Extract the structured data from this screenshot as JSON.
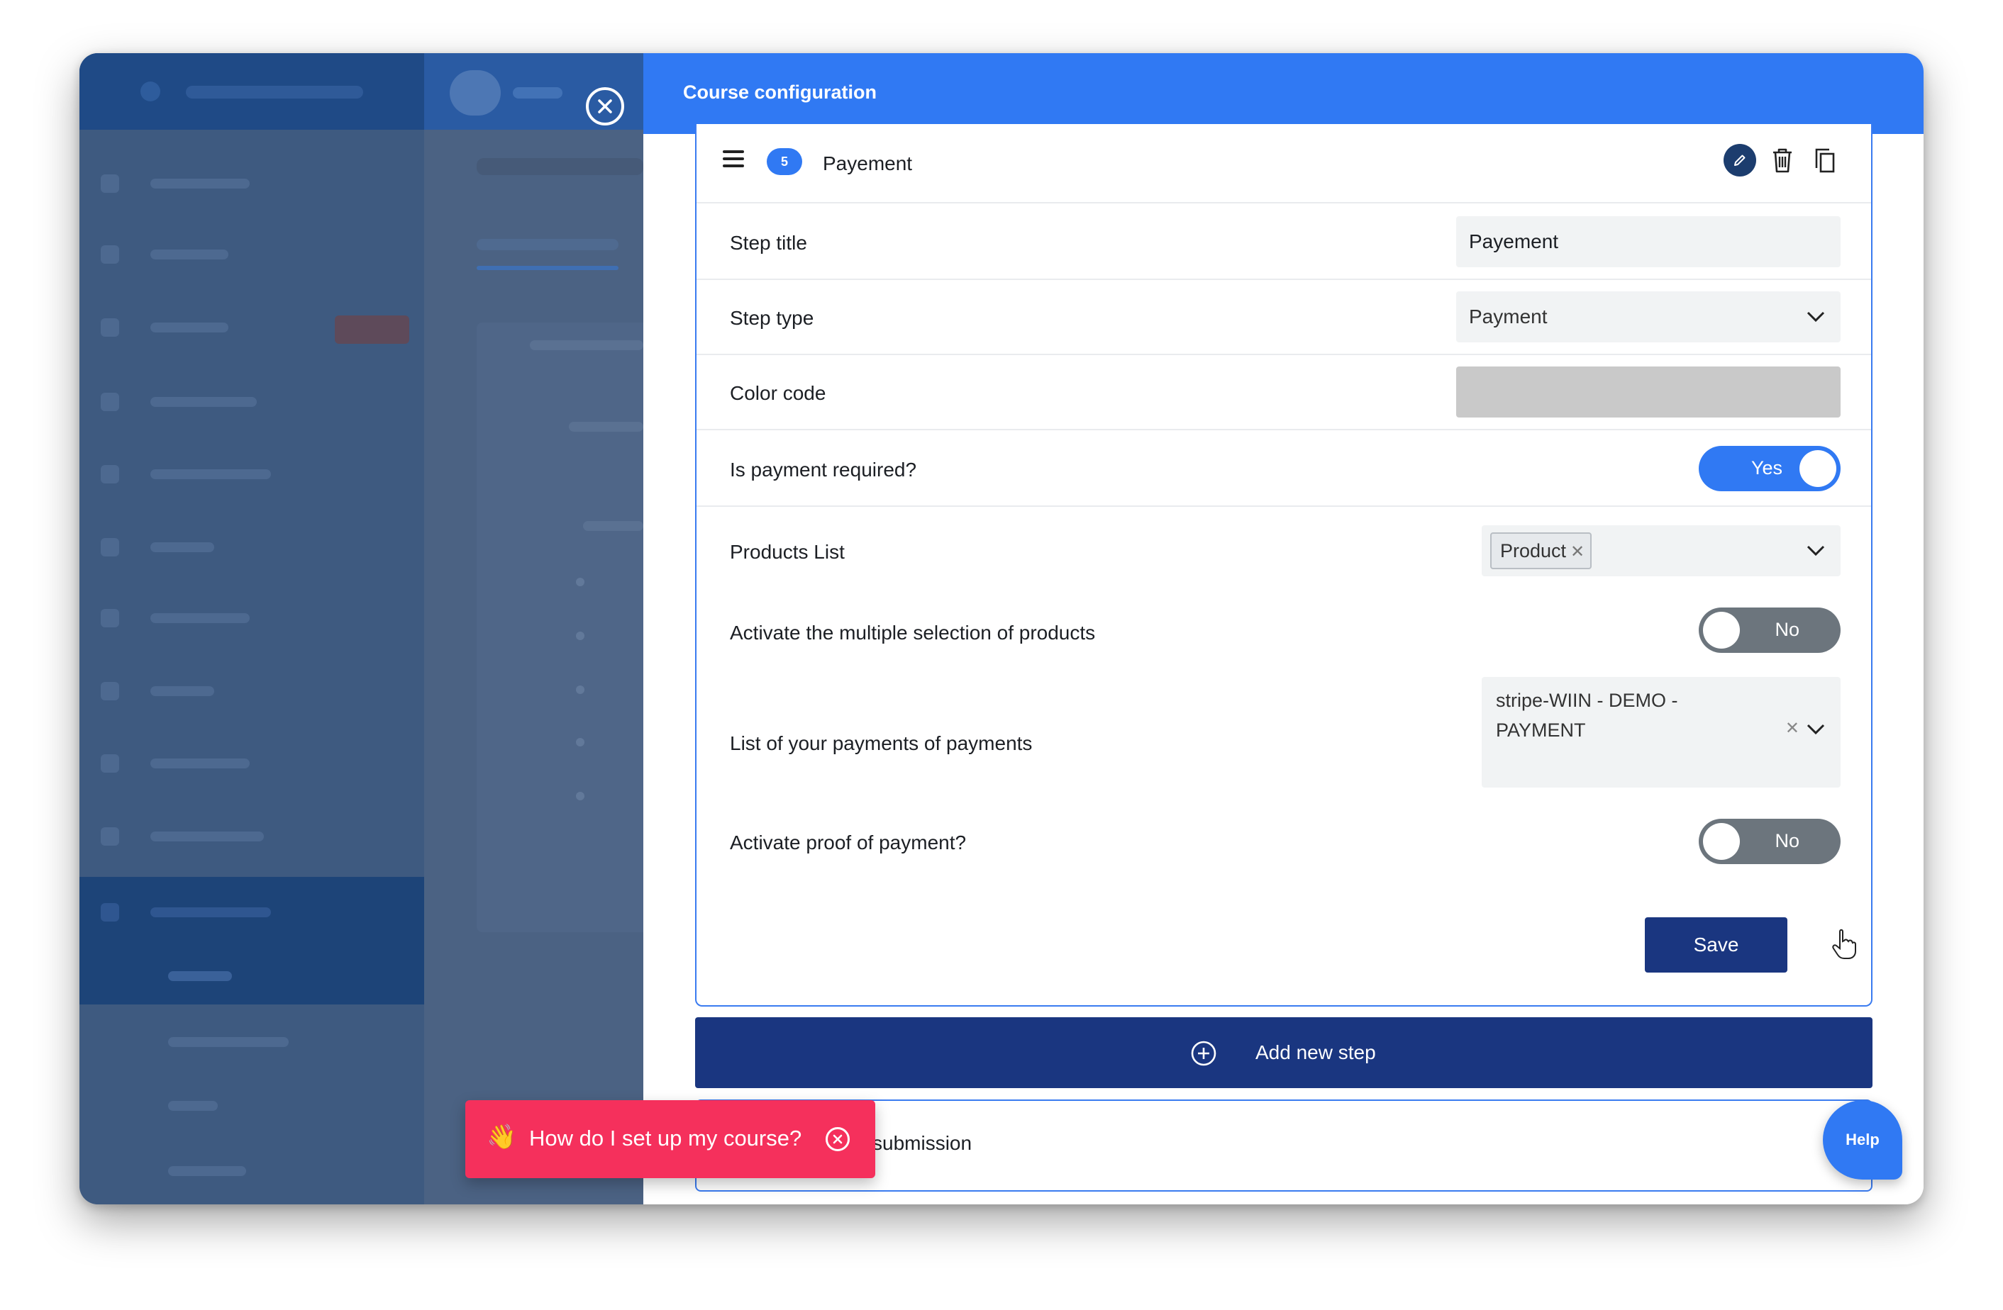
{
  "drawer": {
    "title": "Course configuration"
  },
  "step": {
    "number": "5",
    "name": "Payement"
  },
  "fields": {
    "step_title": {
      "label": "Step title",
      "value": "Payement"
    },
    "step_type": {
      "label": "Step type",
      "value": "Payment"
    },
    "color_code": {
      "label": "Color code",
      "color": "#c9c9c9"
    },
    "payment_required": {
      "label": "Is payment required?",
      "state": "Yes"
    },
    "products_list": {
      "label": "Products List",
      "chip": "Product"
    },
    "multiple_selection": {
      "label": "Activate the multiple selection of products",
      "state": "No"
    },
    "payments_list": {
      "label": "List of your payments of payments",
      "value": "stripe-WIIN - DEMO - PAYMENT"
    },
    "proof_of_payment": {
      "label": "Activate proof of payment?",
      "state": "No"
    }
  },
  "actions": {
    "save_label": "Save",
    "add_step_label": "Add new step"
  },
  "next_step": {
    "label": "submission"
  },
  "help": {
    "label": "Help"
  },
  "toast": {
    "emoji": "👋",
    "text": "How do I set up my course?"
  },
  "colors": {
    "primary": "#3079f3",
    "navy": "#1a3680",
    "toast": "#f5305c"
  }
}
